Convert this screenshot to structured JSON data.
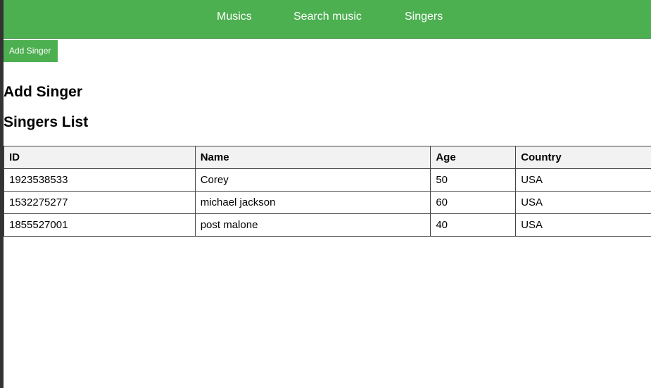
{
  "nav": {
    "links": [
      "Musics",
      "Search music",
      "Singers"
    ]
  },
  "tab": {
    "add_singer_label": "Add Singer"
  },
  "headings": {
    "add": "Add Singer",
    "list": "Singers List"
  },
  "table": {
    "columns": [
      "ID",
      "Name",
      "Age",
      "Country"
    ],
    "rows": [
      [
        "1923538533",
        "Corey",
        "50",
        "USA"
      ],
      [
        "1532275277",
        "michael jackson",
        "60",
        "USA"
      ],
      [
        "1855527001",
        "post malone",
        "40",
        "USA"
      ]
    ]
  },
  "colors": {
    "accent": "#4caf50",
    "header_bg": "#f2f2f2",
    "frame": "#333333"
  }
}
